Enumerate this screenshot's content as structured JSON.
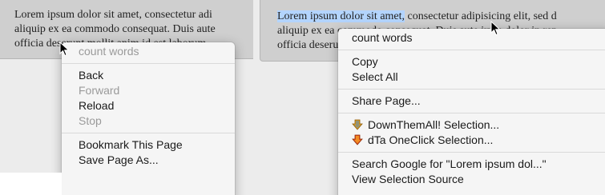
{
  "left": {
    "text_lines": [
      "Lorem ipsum dolor sit amet, consectetur adi",
      "aliquip ex ea commodo consequat. Duis aute",
      "officia deserunt mollit anim id est laborum."
    ],
    "menu": {
      "header": "count words",
      "nav_items": [
        {
          "label": "Back",
          "disabled": false
        },
        {
          "label": "Forward",
          "disabled": true
        },
        {
          "label": "Reload",
          "disabled": false
        },
        {
          "label": "Stop",
          "disabled": true
        }
      ],
      "page_items": [
        "Bookmark This Page",
        "Save Page As..."
      ]
    }
  },
  "right": {
    "text_line_1_selected": "Lorem ipsum dolor sit amet,",
    "text_line_1_rest": " consectetur adipisicing elit, sed d",
    "text_lines_rest": [
      "aliquip ex ea commodo consequat. Duis aute irure dolor in rep",
      "officia deserunt mollit anim id est laborum."
    ],
    "menu": {
      "header": "count words",
      "copy": "Copy",
      "select_all": "Select All",
      "share_page": "Share Page...",
      "downthemall": "DownThemAll! Selection...",
      "dta_oneclick": "dTa OneClick Selection...",
      "search_google": "Search Google for \"Lorem ipsum dol...\"",
      "view_source": "View Selection Source"
    }
  },
  "colors": {
    "selection": "#b3d4fd",
    "menu_bg": "#f5f5f5",
    "textbox_bg": "#cfcfcf",
    "disabled_text": "#9a9a9a"
  }
}
